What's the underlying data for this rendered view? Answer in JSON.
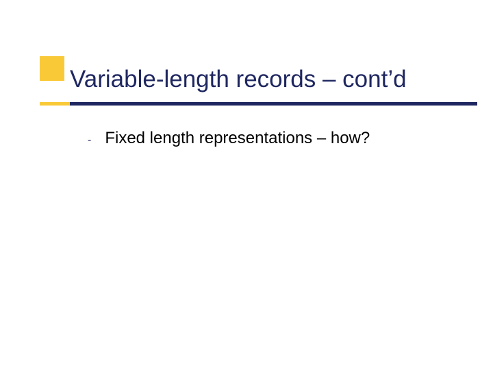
{
  "title": "Variable-length records – cont’d",
  "bullets": [
    {
      "text": "Fixed length representations – how?"
    }
  ],
  "colors": {
    "accent_yellow": "#f9c938",
    "accent_navy": "#1f2760"
  }
}
